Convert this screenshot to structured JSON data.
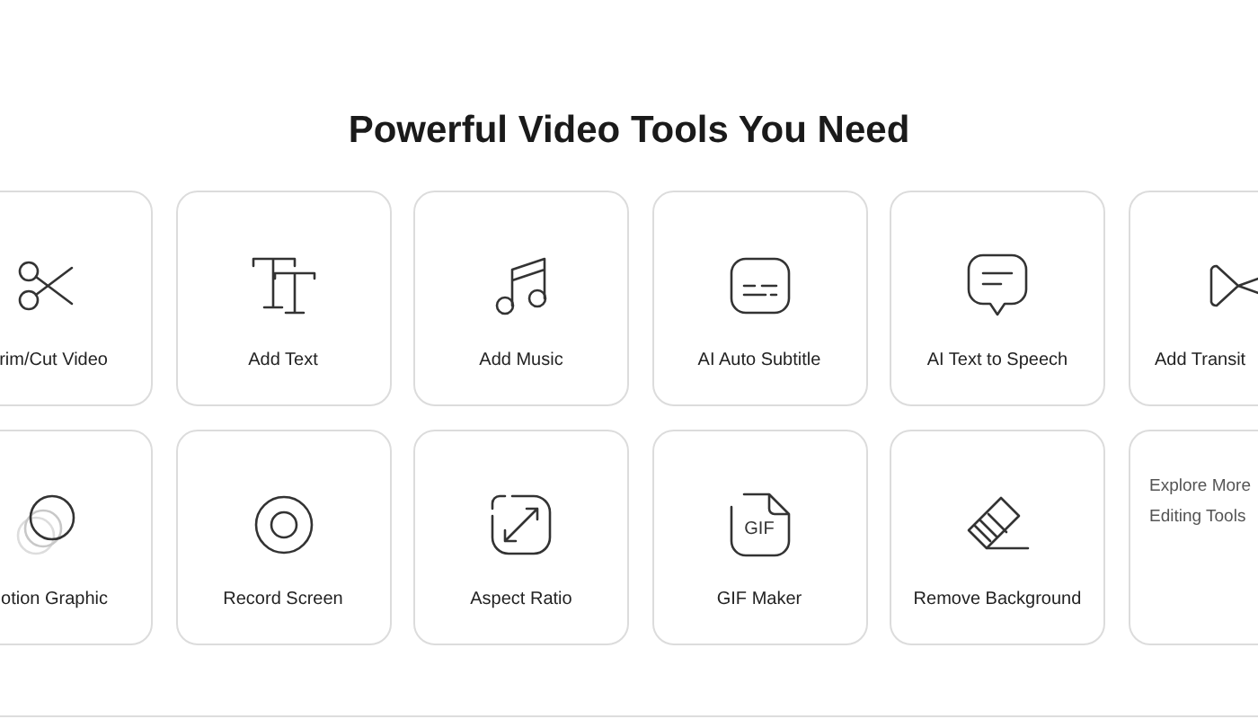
{
  "heading": "Powerful Video Tools You Need",
  "rows": [
    {
      "cards": [
        {
          "kind": "tool",
          "label": "rim/Cut Video"
        },
        {
          "kind": "tool",
          "label": "Add Text"
        },
        {
          "kind": "tool",
          "label": "Add Music"
        },
        {
          "kind": "tool",
          "label": "AI Auto Subtitle"
        },
        {
          "kind": "tool",
          "label": "AI Text to Speech"
        },
        {
          "kind": "tool",
          "label": "Add Transit"
        }
      ]
    },
    {
      "cards": [
        {
          "kind": "tool",
          "label": "otion Graphic"
        },
        {
          "kind": "tool",
          "label": "Record Screen"
        },
        {
          "kind": "tool",
          "label": "Aspect Ratio"
        },
        {
          "kind": "tool",
          "label": "GIF Maker",
          "icon_text": "GIF"
        },
        {
          "kind": "tool",
          "label": "Remove Background"
        },
        {
          "kind": "more",
          "lines": [
            "Explore More",
            "Editing Tools"
          ]
        }
      ]
    }
  ]
}
